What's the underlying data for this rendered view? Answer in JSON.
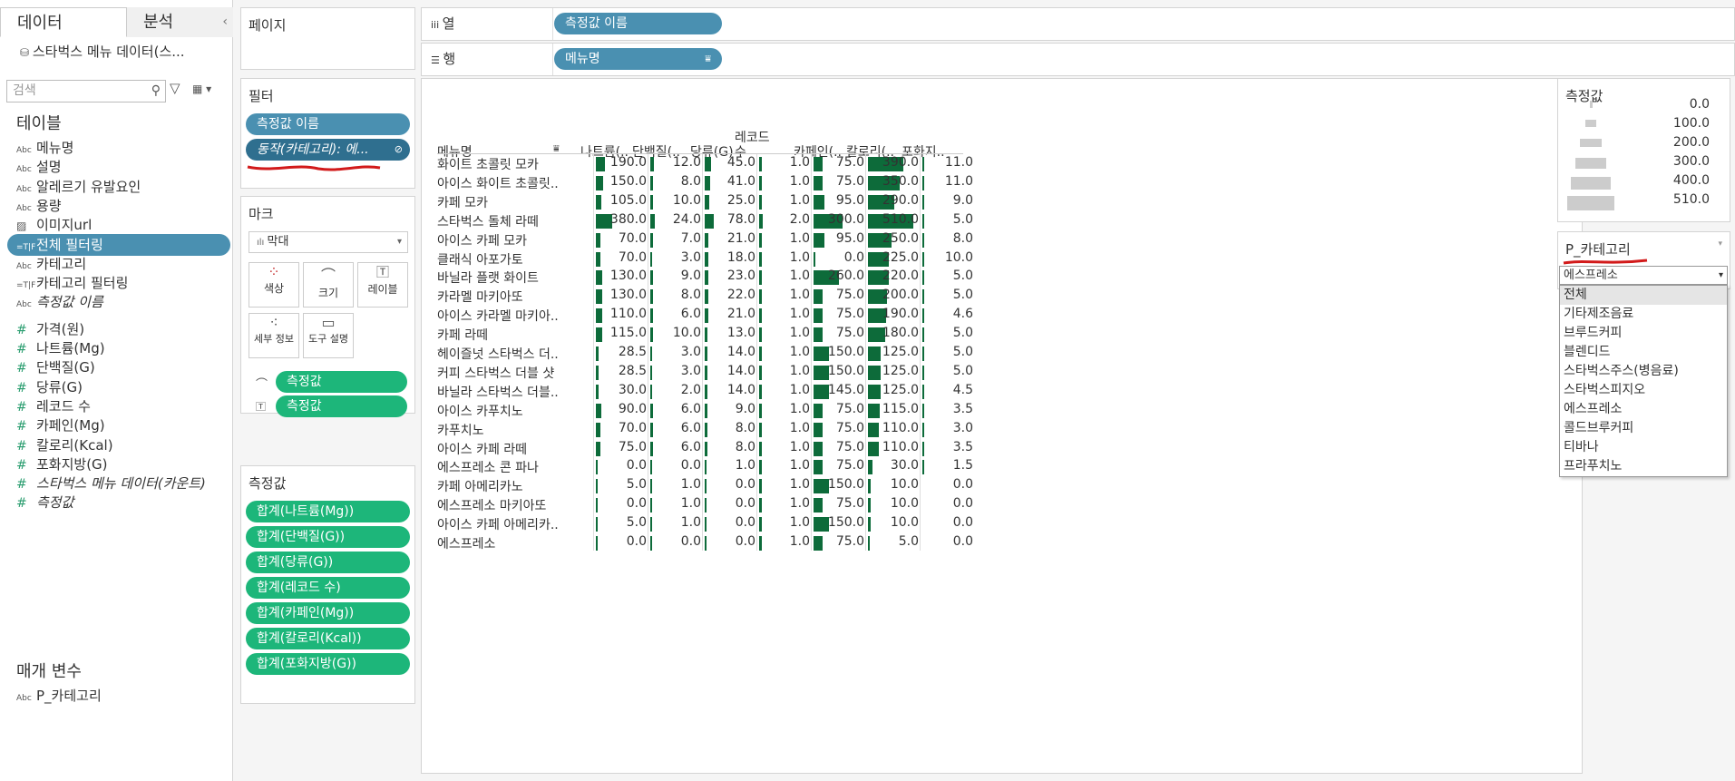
{
  "left": {
    "tab_data": "데이터",
    "tab_analysis": "분석",
    "datasource": "스타벅스 메뉴 데이터(스...",
    "search_placeholder": "검색",
    "tables_header": "테이블",
    "fields": [
      {
        "icon": "Abc",
        "label": "메뉴명"
      },
      {
        "icon": "Abc",
        "label": "설명"
      },
      {
        "icon": "Abc",
        "label": "알레르기 유발요인"
      },
      {
        "icon": "Abc",
        "label": "용량"
      },
      {
        "icon": "image",
        "label": "이미지url"
      },
      {
        "icon": "=T|F",
        "label": "전체 필터링",
        "selected": true
      },
      {
        "icon": "Abc",
        "label": "카테고리"
      },
      {
        "icon": "=T|F",
        "label": "카테고리 필터링"
      },
      {
        "icon": "Abc",
        "label": "측정값 이름",
        "italic": true
      },
      {
        "icon": "#",
        "label": "가격(원)"
      },
      {
        "icon": "#",
        "label": "나트륨(Mg)"
      },
      {
        "icon": "#",
        "label": "단백질(G)"
      },
      {
        "icon": "#",
        "label": "당류(G)"
      },
      {
        "icon": "#",
        "label": "레코드 수"
      },
      {
        "icon": "#",
        "label": "카페인(Mg)"
      },
      {
        "icon": "#",
        "label": "칼로리(Kcal)"
      },
      {
        "icon": "#",
        "label": "포화지방(G)"
      },
      {
        "icon": "#",
        "label": "스타벅스 메뉴 데이터(카운트)",
        "italic": true
      },
      {
        "icon": "#",
        "label": "측정값",
        "italic": true
      }
    ],
    "params_header": "매개 변수",
    "param_field": {
      "icon": "Abc",
      "label": "P_카테고리"
    }
  },
  "pages": {
    "title": "페이지"
  },
  "filters": {
    "title": "필터",
    "pills": [
      "측정값 이름",
      "동작(카테고리): 에..."
    ]
  },
  "marks": {
    "title": "마크",
    "type": "막대",
    "buttons": [
      "색상",
      "크기",
      "레이블",
      "세부 정보",
      "도구 설명"
    ],
    "pills": [
      "측정값",
      "측정값"
    ]
  },
  "measures": {
    "title": "측정값",
    "pills": [
      "합계(나트륨(Mg))",
      "합계(단백질(G))",
      "합계(당류(G))",
      "합계(레코드 수)",
      "합계(카페인(Mg))",
      "합계(칼로리(Kcal))",
      "합계(포화지방(G))"
    ]
  },
  "shelves": {
    "columns_label": "열",
    "columns_pill": "측정값 이름",
    "rows_label": "행",
    "rows_pill": "메뉴명"
  },
  "view": {
    "headers": [
      "메뉴명",
      "나트륨(..",
      "단백질(..",
      "당류(G)",
      "레코드",
      "수",
      "카페인(..",
      "칼로리(..",
      "포화지.."
    ],
    "rows": [
      {
        "name": "화이트 초콜릿 모카",
        "v": [
          "190.0",
          "12.0",
          "45.0",
          "1.0",
          "75.0",
          "390.0",
          "11.0"
        ]
      },
      {
        "name": "아이스 화이트 초콜릿..",
        "v": [
          "150.0",
          "8.0",
          "41.0",
          "1.0",
          "75.0",
          "350.0",
          "11.0"
        ]
      },
      {
        "name": "카페 모카",
        "v": [
          "105.0",
          "10.0",
          "25.0",
          "1.0",
          "95.0",
          "290.0",
          "9.0"
        ]
      },
      {
        "name": "스타벅스 돌체 라떼",
        "v": [
          "380.0",
          "24.0",
          "78.0",
          "2.0",
          "300.0",
          "510.0",
          "5.0"
        ]
      },
      {
        "name": "아이스 카페 모카",
        "v": [
          "70.0",
          "7.0",
          "21.0",
          "1.0",
          "95.0",
          "250.0",
          "8.0"
        ]
      },
      {
        "name": "클래식 아포가토",
        "v": [
          "70.0",
          "3.0",
          "18.0",
          "1.0",
          "0.0",
          "225.0",
          "10.0"
        ]
      },
      {
        "name": "바닐라 플랫 화이트",
        "v": [
          "130.0",
          "9.0",
          "23.0",
          "1.0",
          "260.0",
          "220.0",
          "5.0"
        ]
      },
      {
        "name": "카라멜 마키아또",
        "v": [
          "130.0",
          "8.0",
          "22.0",
          "1.0",
          "75.0",
          "200.0",
          "5.0"
        ]
      },
      {
        "name": "아이스 카라멜 마키아..",
        "v": [
          "110.0",
          "6.0",
          "21.0",
          "1.0",
          "75.0",
          "190.0",
          "4.6"
        ]
      },
      {
        "name": "카페 라떼",
        "v": [
          "115.0",
          "10.0",
          "13.0",
          "1.0",
          "75.0",
          "180.0",
          "5.0"
        ]
      },
      {
        "name": "헤이즐넛 스타벅스 더..",
        "v": [
          "28.5",
          "3.0",
          "14.0",
          "1.0",
          "150.0",
          "125.0",
          "5.0"
        ]
      },
      {
        "name": "커피 스타벅스 더블 샷",
        "v": [
          "28.5",
          "3.0",
          "14.0",
          "1.0",
          "150.0",
          "125.0",
          "5.0"
        ]
      },
      {
        "name": "바닐라 스타벅스 더블..",
        "v": [
          "30.0",
          "2.0",
          "14.0",
          "1.0",
          "145.0",
          "125.0",
          "4.5"
        ]
      },
      {
        "name": "아이스 카푸치노",
        "v": [
          "90.0",
          "6.0",
          "9.0",
          "1.0",
          "75.0",
          "115.0",
          "3.5"
        ]
      },
      {
        "name": "카푸치노",
        "v": [
          "70.0",
          "6.0",
          "8.0",
          "1.0",
          "75.0",
          "110.0",
          "3.0"
        ]
      },
      {
        "name": "아이스 카페 라떼",
        "v": [
          "75.0",
          "6.0",
          "8.0",
          "1.0",
          "75.0",
          "110.0",
          "3.5"
        ]
      },
      {
        "name": "에스프레소 콘 파나",
        "v": [
          "0.0",
          "0.0",
          "1.0",
          "1.0",
          "75.0",
          "30.0",
          "1.5"
        ]
      },
      {
        "name": "카페 아메리카노",
        "v": [
          "5.0",
          "1.0",
          "0.0",
          "1.0",
          "150.0",
          "10.0",
          "0.0"
        ]
      },
      {
        "name": "에스프레소 마키아또",
        "v": [
          "0.0",
          "1.0",
          "0.0",
          "1.0",
          "75.0",
          "10.0",
          "0.0"
        ]
      },
      {
        "name": "아이스 카페 아메리카..",
        "v": [
          "5.0",
          "1.0",
          "0.0",
          "1.0",
          "150.0",
          "10.0",
          "0.0"
        ]
      },
      {
        "name": "에스프레소",
        "v": [
          "0.0",
          "0.0",
          "0.0",
          "1.0",
          "75.0",
          "5.0",
          "0.0"
        ]
      }
    ],
    "bar_color": "#0d6b3a"
  },
  "legend": {
    "title": "측정값",
    "values": [
      "0.0",
      "100.0",
      "200.0",
      "300.0",
      "400.0",
      "510.0"
    ]
  },
  "param": {
    "title": "P_카테고리",
    "value": "에스프레소",
    "options": [
      "전체",
      "기타제조음료",
      "브루드커피",
      "블렌디드",
      "스타벅스주스(병음료)",
      "스타벅스피지오",
      "에스프레소",
      "콜드브루커피",
      "티바나",
      "프라푸치노"
    ]
  }
}
